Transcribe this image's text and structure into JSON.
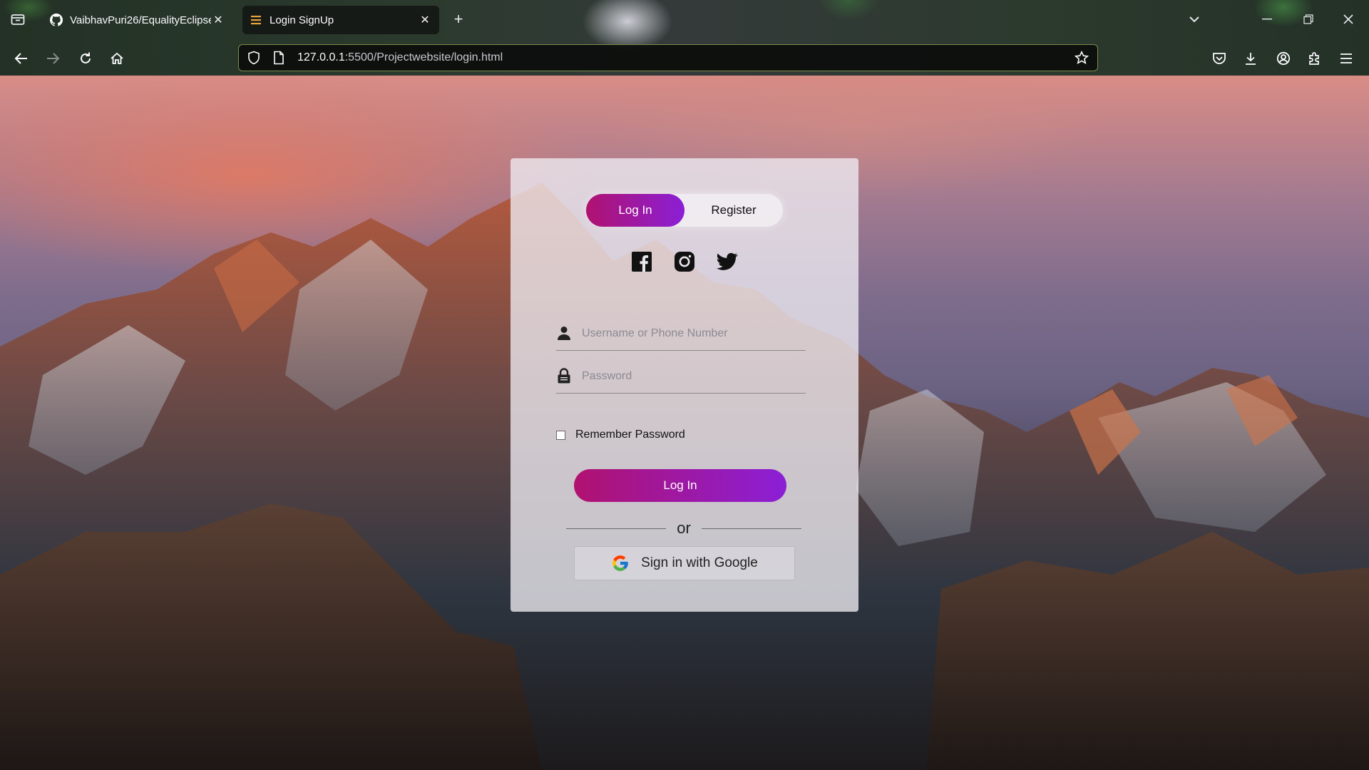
{
  "browser": {
    "tabs": [
      {
        "title": "VaibhavPuri26/EqualityEclipse",
        "favicon": "github-icon",
        "active": false
      },
      {
        "title": "Login SignUp",
        "favicon": "page-lines-icon",
        "active": true
      }
    ],
    "url_host": "127.0.0.1",
    "url_path": ":5500/Projectwebsite/login.html",
    "accent_color": "#7d8a4c"
  },
  "login_card": {
    "toggle": {
      "login_label": "Log In",
      "register_label": "Register",
      "selected": "Log In"
    },
    "socials": [
      "facebook-icon",
      "instagram-icon",
      "twitter-icon"
    ],
    "username_placeholder": "Username or Phone Number",
    "password_placeholder": "Password",
    "remember_label": "Remember Password",
    "submit_label": "Log In",
    "divider_text": "or",
    "google_label": "Sign in with Google",
    "gradient": [
      "#b0126f",
      "#8b1fd6"
    ]
  }
}
